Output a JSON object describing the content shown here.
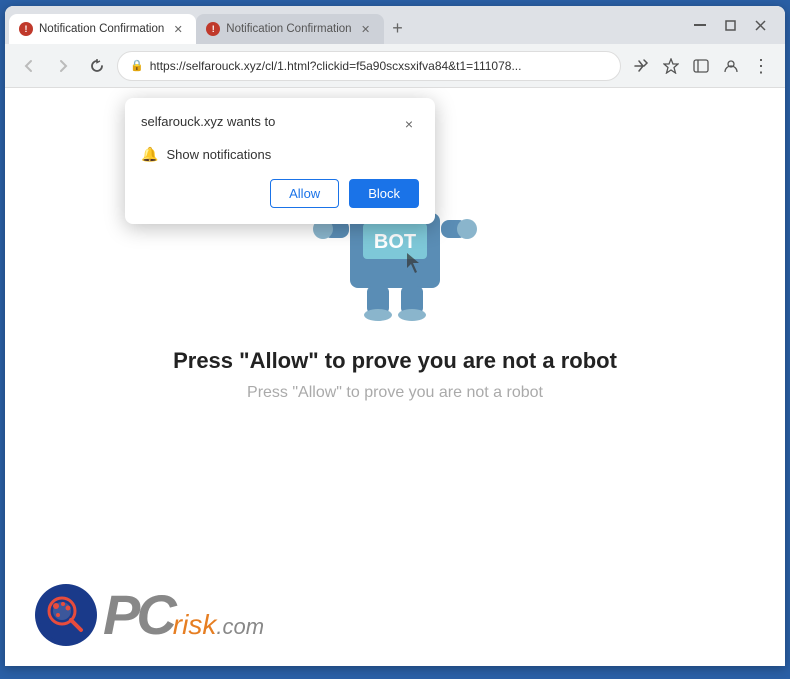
{
  "browser": {
    "tabs": [
      {
        "id": "tab1",
        "title": "Notification Confirmation",
        "favicon": "!",
        "active": true
      },
      {
        "id": "tab2",
        "title": "Notification Confirmation",
        "favicon": "!",
        "active": false
      }
    ],
    "new_tab_label": "+",
    "window_controls": {
      "minimize": "─",
      "maximize": "□",
      "close": "✕"
    },
    "address_bar": {
      "url": "https://selfarouck.xyz/cl/1.html?clickid=f5a90scxsxifva84&t1=111078...",
      "lock_icon": "🔒"
    },
    "nav": {
      "back": "←",
      "forward": "→",
      "refresh": "↻"
    },
    "toolbar": {
      "share": "↗",
      "star": "☆",
      "sidebar": "▥",
      "profile": "👤",
      "menu": "⋮"
    }
  },
  "notification_popup": {
    "title": "selfarouck.xyz wants to",
    "close_label": "×",
    "bell_icon": "🔔",
    "notification_option": "Show notifications",
    "allow_button": "Allow",
    "block_button": "Block"
  },
  "page": {
    "main_text": "Press \"Allow\" to prove you are not a robot",
    "sub_text": "Press \"Allow\" to prove you are not a robot",
    "bot_label": "BOT"
  },
  "logo": {
    "pc_text": "PC",
    "risk_text": "risk",
    "com_text": ".com"
  }
}
